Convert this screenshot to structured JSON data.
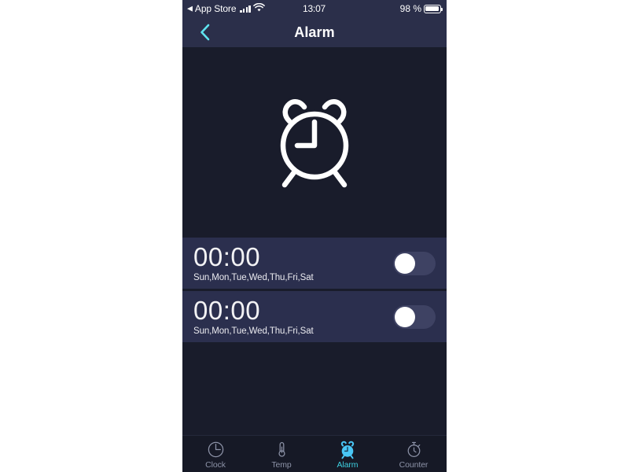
{
  "status_bar": {
    "back_label": "App Store",
    "back_arrow": "back-triangle-icon",
    "signal_icon": "cellular-signal-icon",
    "wifi_icon": "wifi-icon",
    "time": "13:07",
    "battery_percent": "98 %",
    "battery_icon": "battery-full-icon"
  },
  "nav_bar": {
    "back_icon": "chevron-left-icon",
    "title": "Alarm"
  },
  "hero": {
    "icon": "alarm-clock-icon"
  },
  "alarms": [
    {
      "time": "00:00",
      "days": "Sun,Mon,Tue,Wed,Thu,Fri,Sat",
      "enabled": "off"
    },
    {
      "time": "00:00",
      "days": "Sun,Mon,Tue,Wed,Thu,Fri,Sat",
      "enabled": "off"
    }
  ],
  "tab_bar": {
    "tabs": [
      {
        "label": "Clock",
        "icon": "clock-icon",
        "active": "false"
      },
      {
        "label": "Temp",
        "icon": "thermometer-icon",
        "active": "false"
      },
      {
        "label": "Alarm",
        "icon": "alarm-clock-icon",
        "active": "true"
      },
      {
        "label": "Counter",
        "icon": "stopwatch-icon",
        "active": "false"
      }
    ]
  },
  "colors": {
    "page_background": "#191c2b",
    "bar_background": "#2b2f4a",
    "row_background": "#2b2f4e",
    "accent": "#3ecfe0",
    "tab_inactive": "#8d93a8",
    "text_primary": "#ffffff",
    "toggle_track_off": "#3e4263",
    "outside_frame": "#ffffff"
  }
}
